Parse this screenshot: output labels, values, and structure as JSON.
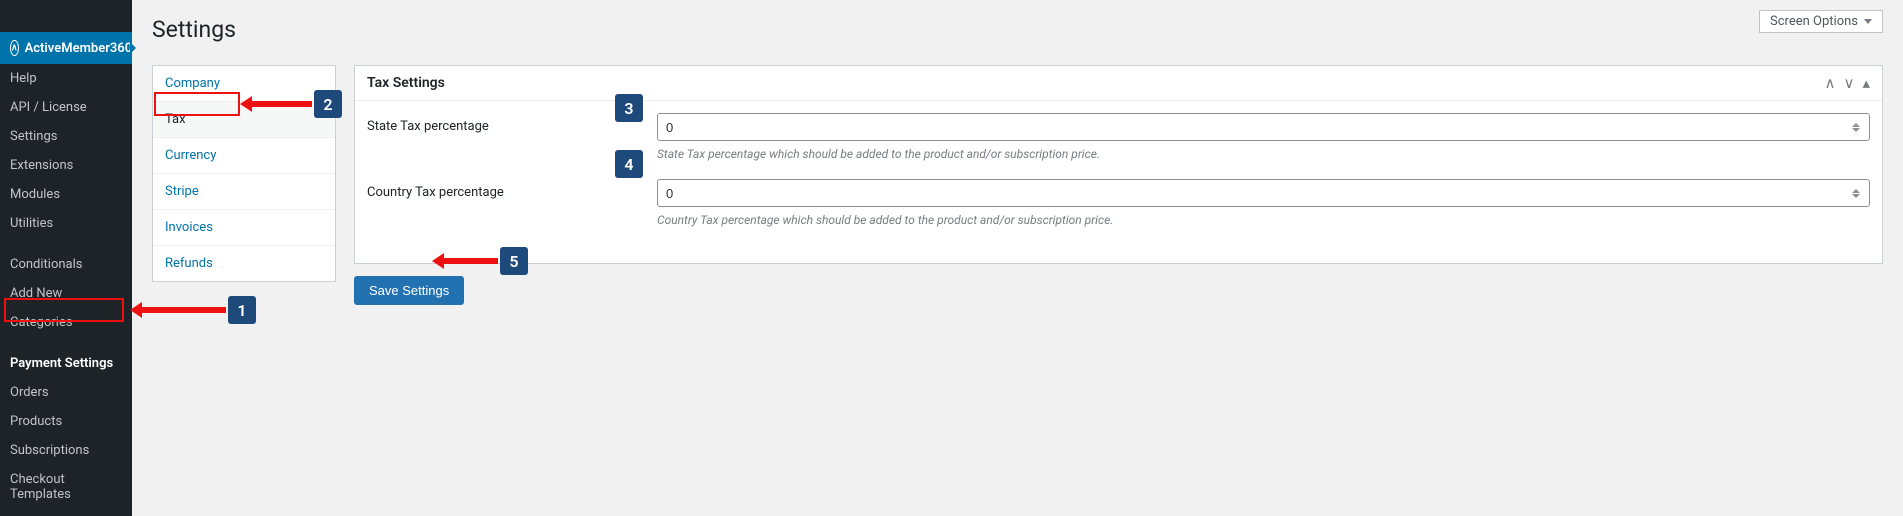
{
  "sidebar": {
    "brand": "ActiveMember360",
    "items": [
      {
        "label": "Help"
      },
      {
        "label": "API / License"
      },
      {
        "label": "Settings"
      },
      {
        "label": "Extensions"
      },
      {
        "label": "Modules"
      },
      {
        "label": "Utilities"
      }
    ],
    "items2": [
      {
        "label": "Conditionals"
      },
      {
        "label": "Add New"
      },
      {
        "label": "Categories"
      }
    ],
    "items3": [
      {
        "label": "Payment Settings",
        "active": true
      },
      {
        "label": "Orders"
      },
      {
        "label": "Products"
      },
      {
        "label": "Subscriptions"
      },
      {
        "label": "Checkout Templates"
      }
    ]
  },
  "header": {
    "title": "Settings",
    "screen_options": "Screen Options"
  },
  "tabs": [
    {
      "label": "Company"
    },
    {
      "label": "Tax",
      "active": true
    },
    {
      "label": "Currency"
    },
    {
      "label": "Stripe"
    },
    {
      "label": "Invoices"
    },
    {
      "label": "Refunds"
    }
  ],
  "panel": {
    "title": "Tax Settings",
    "state_tax": {
      "label": "State Tax percentage",
      "value": "0",
      "help": "State Tax percentage which should be added to the product and/or subscription price."
    },
    "country_tax": {
      "label": "Country Tax percentage",
      "value": "0",
      "help": "Country Tax percentage which should be added to the product and/or subscription price."
    },
    "save_label": "Save Settings"
  },
  "callouts": {
    "n1": "1",
    "n2": "2",
    "n3": "3",
    "n4": "4",
    "n5": "5"
  }
}
